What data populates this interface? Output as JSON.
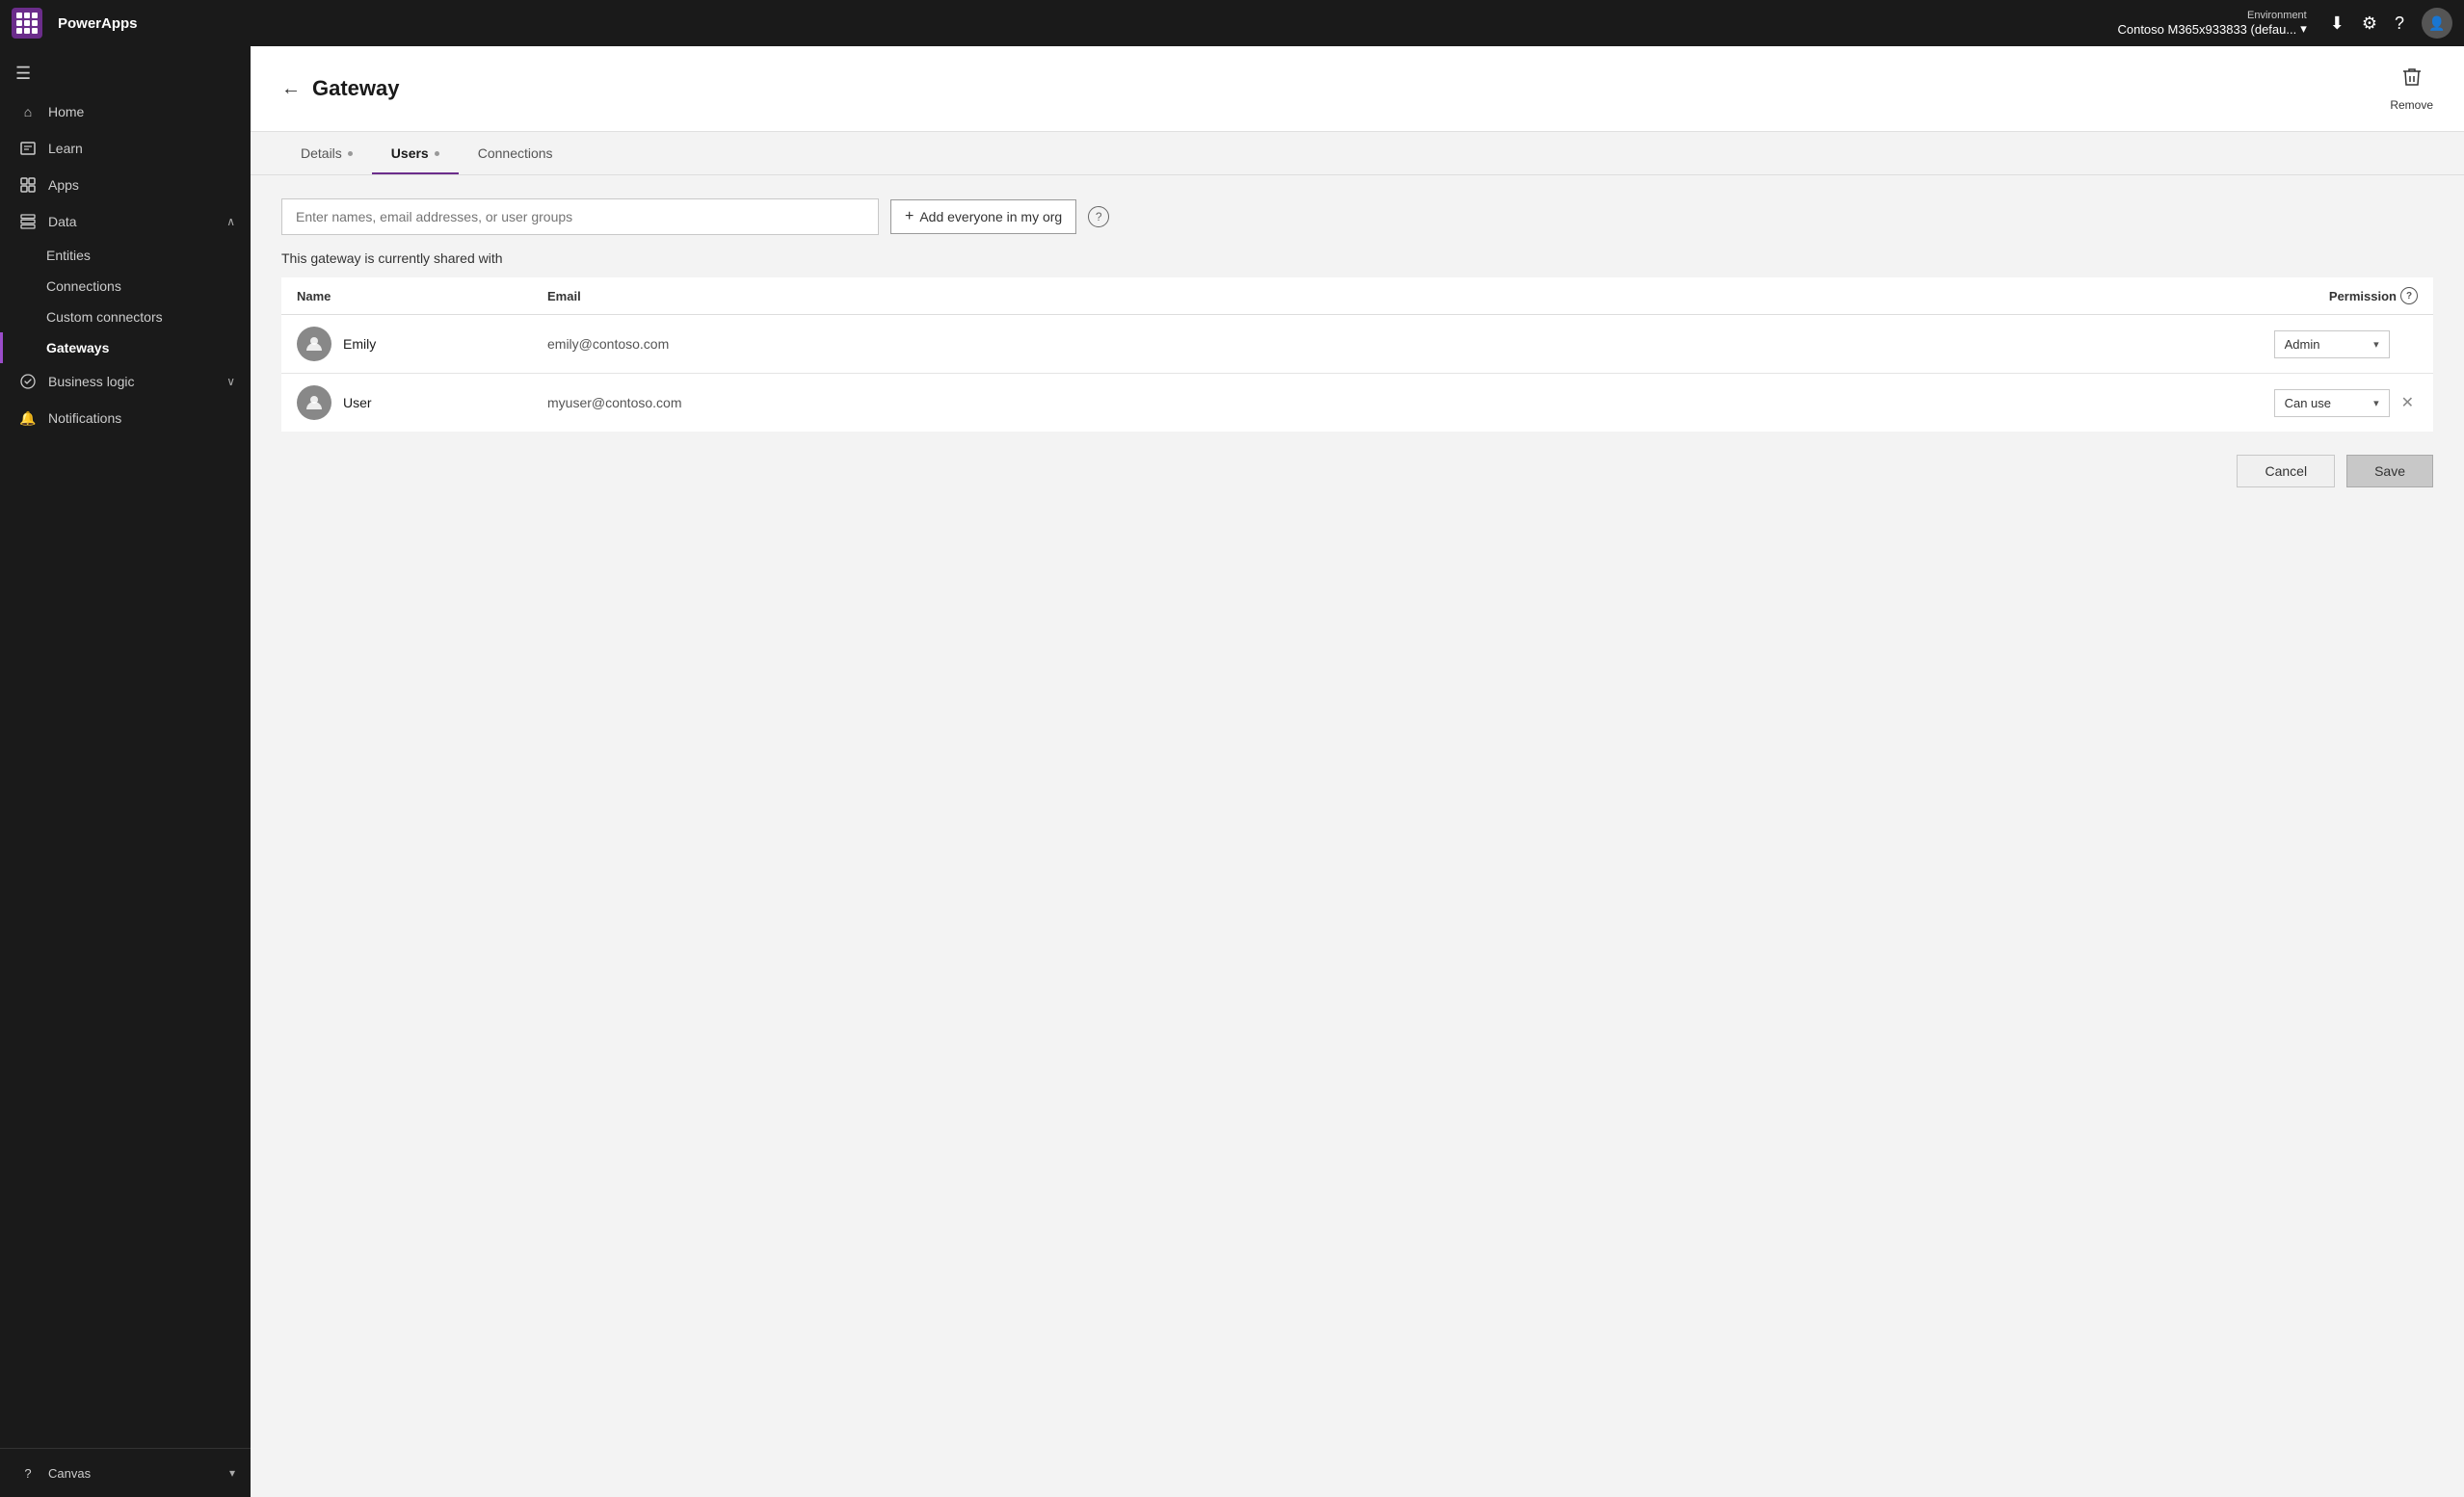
{
  "topbar": {
    "app_name": "PowerApps",
    "env_label": "Environment",
    "env_name": "Contoso M365x933833 (defau...",
    "chevron": "▾"
  },
  "sidebar": {
    "hamburger_icon": "☰",
    "items": [
      {
        "id": "home",
        "label": "Home",
        "icon": "⌂",
        "has_chevron": false
      },
      {
        "id": "learn",
        "label": "Learn",
        "icon": "📖",
        "has_chevron": false
      },
      {
        "id": "apps",
        "label": "Apps",
        "icon": "⊞",
        "has_chevron": false
      },
      {
        "id": "data",
        "label": "Data",
        "icon": "▦",
        "has_chevron": true,
        "expanded": true
      }
    ],
    "sub_items": [
      {
        "id": "entities",
        "label": "Entities"
      },
      {
        "id": "connections",
        "label": "Connections"
      },
      {
        "id": "custom_connectors",
        "label": "Custom connectors"
      },
      {
        "id": "gateways",
        "label": "Gateways",
        "active": true
      }
    ],
    "bottom_items": [
      {
        "id": "business_logic",
        "label": "Business logic",
        "icon": "⟨⟩",
        "has_chevron": true
      },
      {
        "id": "notifications",
        "label": "Notifications",
        "icon": "🔔",
        "has_chevron": false
      }
    ],
    "footer": {
      "item": "Canvas",
      "icon": "?",
      "chevron": "▾"
    }
  },
  "page": {
    "title": "Gateway",
    "back_icon": "←",
    "remove_label": "Remove"
  },
  "tabs": [
    {
      "id": "details",
      "label": "Details",
      "active": false,
      "has_dot": true
    },
    {
      "id": "users",
      "label": "Users",
      "active": true,
      "has_dot": true
    },
    {
      "id": "connections",
      "label": "Connections",
      "active": false,
      "has_dot": false
    }
  ],
  "users_tab": {
    "search_placeholder": "Enter names, email addresses, or user groups",
    "add_everyone_label": "Add everyone in my org",
    "shared_with_text": "This gateway is currently shared with",
    "table": {
      "col_name": "Name",
      "col_email": "Email",
      "col_permission": "Permission"
    },
    "users": [
      {
        "name": "Emily",
        "email": "emily@contoso.com",
        "permission": "Admin",
        "can_remove": false
      },
      {
        "name": "User",
        "email": "myuser@contoso.com",
        "permission": "Can use",
        "can_remove": true
      }
    ],
    "cancel_label": "Cancel",
    "save_label": "Save"
  }
}
